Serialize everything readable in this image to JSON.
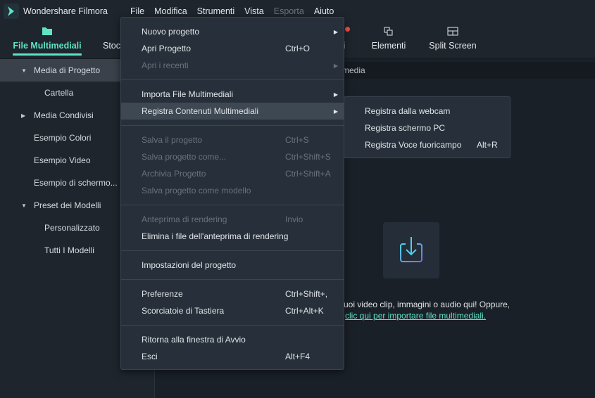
{
  "app": {
    "title": "Wondershare Filmora"
  },
  "menubar": [
    {
      "label": "File"
    },
    {
      "label": "Modifica"
    },
    {
      "label": "Strumenti"
    },
    {
      "label": "Vista"
    },
    {
      "label": "Esporta",
      "disabled": true
    },
    {
      "label": "Aiuto"
    }
  ],
  "toolbar": {
    "tabs": [
      {
        "label": "File Multimediali",
        "icon": "folder-icon",
        "active": true
      },
      {
        "label": "Stoc"
      },
      {
        "label": "ti"
      },
      {
        "label": "Elementi",
        "icon": "elements-icon"
      },
      {
        "label": "Split Screen",
        "icon": "split-screen-icon"
      }
    ],
    "notification_color": "#f04d45"
  },
  "sidebar": {
    "items": [
      {
        "label": "Media di Progetto",
        "level": 0,
        "expanded": true,
        "selected": true
      },
      {
        "label": "Cartella",
        "level": 1
      },
      {
        "label": "Media Condivisi",
        "level": 0,
        "collapsed": true
      },
      {
        "label": "Esempio Colori",
        "level": 0
      },
      {
        "label": "Esempio Video",
        "level": 0
      },
      {
        "label": "Esempio di schermo...",
        "level": 0
      },
      {
        "label": "Preset dei Modelli",
        "level": 0,
        "expanded": true
      },
      {
        "label": "Personalizzato",
        "level": 1
      },
      {
        "label": "Tutti I Modelli",
        "level": 1
      }
    ]
  },
  "search": {
    "value": "media"
  },
  "dropzone": {
    "icon": "import-icon",
    "text": "uoi video clip, immagini o audio qui! Oppure,",
    "link": "clic qui per importare file multimediali."
  },
  "file_menu": {
    "groups": [
      [
        {
          "label": "Nuovo progetto",
          "submenu": true
        },
        {
          "label": "Apri Progetto",
          "shortcut": "Ctrl+O"
        },
        {
          "label": "Apri i recenti",
          "submenu": true,
          "disabled": true
        }
      ],
      [
        {
          "label": "Importa File Multimediali",
          "submenu": true
        },
        {
          "label": "Registra Contenuti Multimediali",
          "submenu": true,
          "highlighted": true
        }
      ],
      [
        {
          "label": "Salva il progetto",
          "shortcut": "Ctrl+S",
          "disabled": true
        },
        {
          "label": "Salva progetto come...",
          "shortcut": "Ctrl+Shift+S",
          "disabled": true
        },
        {
          "label": "Archivia Progetto",
          "shortcut": "Ctrl+Shift+A",
          "disabled": true
        },
        {
          "label": "Salva progetto come modello",
          "disabled": true
        }
      ],
      [
        {
          "label": "Anteprima di rendering",
          "shortcut": "Invio",
          "disabled": true
        },
        {
          "label": "Elimina i file dell'anteprima di rendering"
        }
      ],
      [
        {
          "label": "Impostazioni del progetto"
        }
      ],
      [
        {
          "label": "Preferenze",
          "shortcut": "Ctrl+Shift+,"
        },
        {
          "label": "Scorciatoie di Tastiera",
          "shortcut": "Ctrl+Alt+K"
        }
      ],
      [
        {
          "label": "Ritorna alla finestra di Avvio"
        },
        {
          "label": "Esci",
          "shortcut": "Alt+F4"
        }
      ]
    ]
  },
  "record_submenu": [
    {
      "label": "Registra dalla webcam"
    },
    {
      "label": "Registra schermo PC"
    },
    {
      "label": "Registra Voce fuoricampo",
      "shortcut": "Alt+R"
    }
  ],
  "colors": {
    "accent": "#5fe3c4",
    "menu_bg": "#27303a",
    "background": "#1a2027"
  }
}
